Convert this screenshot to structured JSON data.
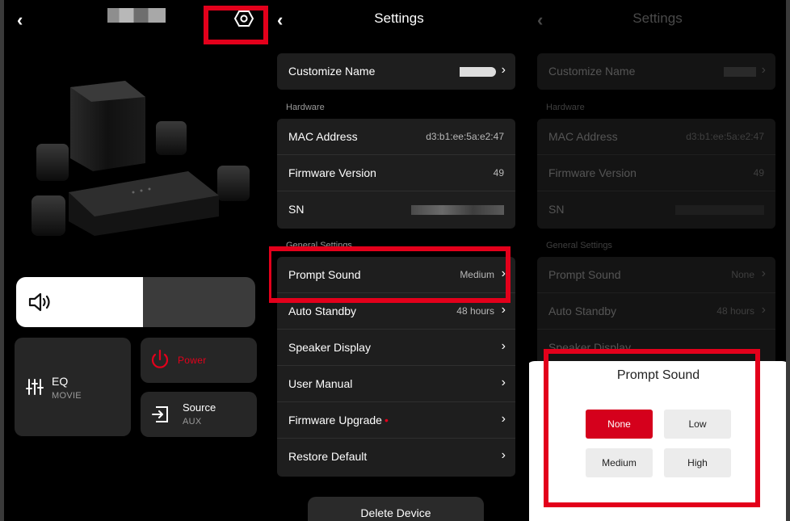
{
  "device_panel": {
    "back_glyph": "‹",
    "volume_percent": 53,
    "eq": {
      "title": "EQ",
      "value": "MOVIE"
    },
    "power": {
      "label": "Power"
    },
    "source": {
      "title": "Source",
      "value": "AUX"
    }
  },
  "settings": {
    "back_glyph": "‹",
    "title": "Settings",
    "customize_name": {
      "label": "Customize Name",
      "chevron": "›"
    },
    "hardware_label": "Hardware",
    "mac": {
      "label": "MAC Address",
      "value": "d3:b1:ee:5a:e2:47"
    },
    "firmware": {
      "label": "Firmware Version",
      "value": "49"
    },
    "sn": {
      "label": "SN"
    },
    "general_label": "General Settings",
    "prompt_sound": {
      "label": "Prompt Sound",
      "value": "Medium",
      "chevron": "›"
    },
    "auto_standby": {
      "label": "Auto Standby",
      "value": "48 hours",
      "chevron": "›"
    },
    "speaker_display": {
      "label": "Speaker Display",
      "chevron": "›"
    },
    "user_manual": {
      "label": "User Manual",
      "chevron": "›"
    },
    "firmware_upgrade": {
      "label": "Firmware Upgrade",
      "badge": "•",
      "chevron": "›"
    },
    "restore_default": {
      "label": "Restore Default",
      "chevron": "›"
    },
    "delete_device": "Delete Device"
  },
  "settings_dim": {
    "back_glyph": "‹",
    "title": "Settings",
    "customize_name": {
      "label": "Customize Name",
      "chevron": "›"
    },
    "hardware_label": "Hardware",
    "mac": {
      "label": "MAC Address",
      "value": "d3:b1:ee:5a:e2:47"
    },
    "firmware": {
      "label": "Firmware Version",
      "value": "49"
    },
    "sn": {
      "label": "SN"
    },
    "general_label": "General Settings",
    "prompt_sound": {
      "label": "Prompt Sound",
      "value": "None",
      "chevron": "›"
    },
    "auto_standby": {
      "label": "Auto Standby",
      "value": "48 hours",
      "chevron": "›"
    },
    "speaker_display": {
      "label": "Speaker Display"
    }
  },
  "prompt_sheet": {
    "title": "Prompt Sound",
    "options": [
      "None",
      "Low",
      "Medium",
      "High"
    ],
    "selected": "None"
  },
  "colors": {
    "accent_red": "#e3001b",
    "selected_red": "#d5001c",
    "card_bg": "#262626"
  }
}
